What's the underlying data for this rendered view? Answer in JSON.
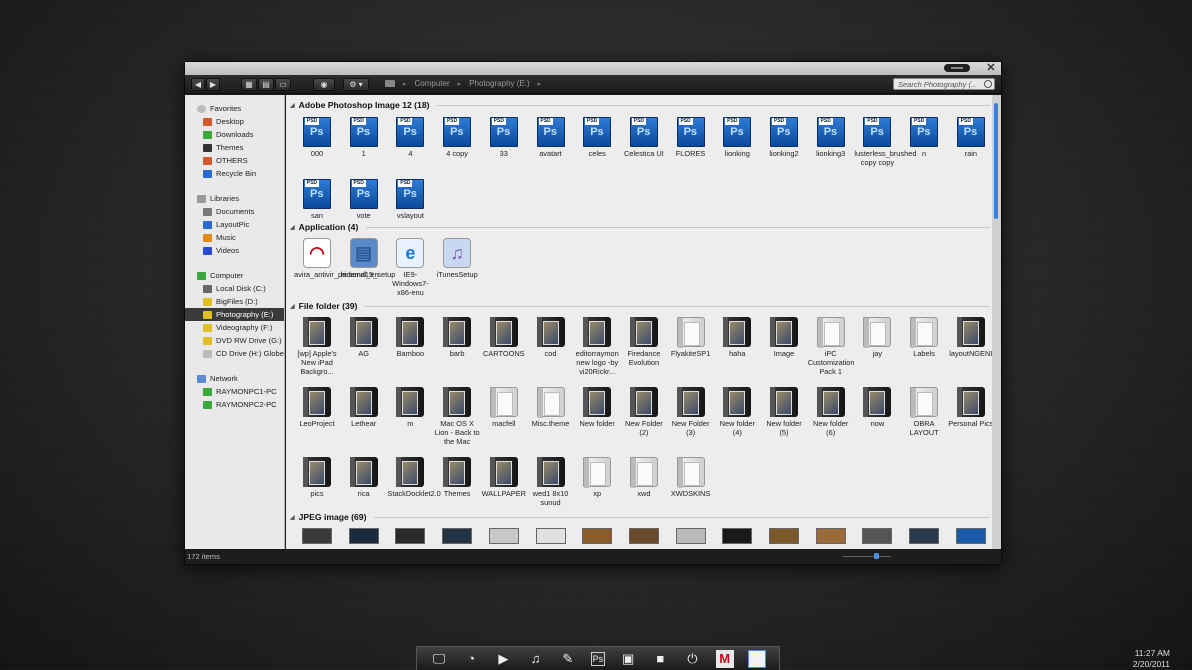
{
  "window": {
    "breadcrumb": [
      "Computer",
      "Photography (E:)"
    ],
    "search_placeholder": "Search Photography (...",
    "status_text": "172 items"
  },
  "nav": {
    "favorites": {
      "title": "Favorites",
      "items": [
        "Desktop",
        "Downloads",
        "Themes",
        "OTHERS",
        "Recycle Bin"
      ]
    },
    "libraries": {
      "title": "Libraries",
      "items": [
        "Documents",
        "LayoutPic",
        "Music",
        "Videos"
      ]
    },
    "computer": {
      "title": "Computer",
      "items": [
        "Local Disk (C:)",
        "BigFiles (D:)",
        "Photography (E:)",
        "Videography (F:)",
        "DVD RW Drive (G:) V",
        "CD Drive (H:) Globe"
      ],
      "selected_index": 2
    },
    "network": {
      "title": "Network",
      "items": [
        "RAYMONPC1-PC",
        "RAYMONPC2-PC"
      ]
    }
  },
  "groups": {
    "psd": {
      "title": "Adobe Photoshop Image 12 (18)",
      "files": [
        "000",
        "1",
        "4",
        "4 copy",
        "33",
        "avatart",
        "celes",
        "Celestica UI",
        "FLORES",
        "lionking",
        "lionking2",
        "lionking3",
        "lusterless_brushed copy copy",
        "n",
        "rain",
        "san",
        "vote",
        "vslayout"
      ]
    },
    "app": {
      "title": "Application (4)",
      "files": [
        "avira_antivir_personal_en",
        "hidemd15_setup",
        "IE9-Windows7-x86-enu",
        "iTunesSetup"
      ]
    },
    "folder": {
      "title": "File folder (39)",
      "files": [
        "[wp] Apple's New iPad Backgro...",
        "AG",
        "Bamboo",
        "barb",
        "CARTOONS",
        "cod",
        "editorraymon new logo -by vi20Rickr...",
        "Firedance Evolution",
        "FlyakiteSP1",
        "haha",
        "Image",
        "iPC Customization Pack 1",
        "jay",
        "Labels",
        "layoutNGENI",
        "LeoProject",
        "Lethear",
        "m",
        "Mac OS X Lion - Back to the Mac",
        "macfell",
        "Misc.theme",
        "New folder",
        "New Folder (2)",
        "New Folder (3)",
        "New folder (4)",
        "New folder (5)",
        "New folder (6)",
        "now",
        "OBRA LAYOUT",
        "Personal Pics",
        "pics",
        "rica",
        "StackDocklet2.0",
        "Themes",
        "WALLPAPER",
        "wed1 8x10 sunud",
        "xp",
        "xwd",
        "XWDSKINS"
      ]
    },
    "jpeg": {
      "title": "JPEG image (69)"
    }
  },
  "clock": {
    "time": "11:27 AM",
    "date": "2/20/2011"
  },
  "colors": {
    "accent": "#3b7fd8",
    "selected_nav": "#3a3a3a"
  }
}
